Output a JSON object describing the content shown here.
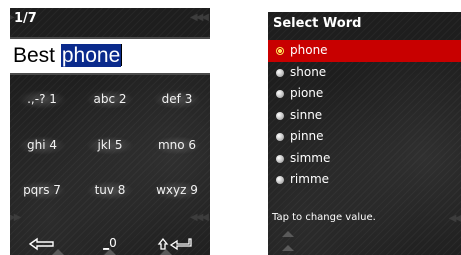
{
  "left_screen": {
    "counter": "1/7",
    "text_prefix": "Best ",
    "text_selected": "phone",
    "keys": [
      ".,-? 1",
      "abc 2",
      "def 3",
      "ghi 4",
      "jkl 5",
      "mno 6",
      "pqrs 7",
      "tuv 8",
      "wxyz 9"
    ],
    "bottom": {
      "backspace_icon": "backspace-arrow-icon",
      "zero_key_underscore": "_",
      "zero_key_digit": "0",
      "shift_enter_icon": "shift-enter-icon"
    }
  },
  "right_screen": {
    "title": "Select Word",
    "words": [
      "phone",
      "shone",
      "pione",
      "sinne",
      "pinne",
      "simme",
      "rimme"
    ],
    "selected_index": 0,
    "hint": "Tap to change value."
  },
  "colors": {
    "screen_bg": "#1e1e1e",
    "selection_blue": "#0a2a8c",
    "highlight_red": "#c80000"
  }
}
